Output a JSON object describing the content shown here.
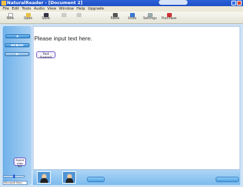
{
  "window": {
    "title": "NaturalReader - [Document 2]"
  },
  "menu": [
    "File",
    "Edit",
    "Tools",
    "Audio",
    "View",
    "Window",
    "Help",
    "Upgrade"
  ],
  "toolbar": [
    {
      "label": "New",
      "icon": "new-document-icon",
      "enabled": true
    },
    {
      "label": "Open",
      "icon": "open-folder-icon",
      "enabled": true
    },
    {
      "label": "Save",
      "icon": "save-disk-icon",
      "enabled": true
    },
    {
      "label": "",
      "icon": "cut-icon",
      "enabled": false
    },
    {
      "label": "",
      "icon": "copy-icon",
      "enabled": false
    },
    {
      "label": "Paste",
      "icon": "paste-icon",
      "enabled": true
    },
    {
      "label": "Undo",
      "icon": "undo-icon",
      "enabled": true
    },
    {
      "label": "Settings",
      "icon": "settings-icon",
      "enabled": true
    },
    {
      "label": "Purchase",
      "icon": "purchase-icon",
      "enabled": true
    }
  ],
  "editor": {
    "placeholder": "Please input text here."
  },
  "callouts": {
    "fast_forward": "Fast forward",
    "speed_slide_bar": "Speed slide bar"
  },
  "speed": {
    "select_value": "Microsoft Mary"
  },
  "colors": {
    "titlebar": "#2c62d8",
    "pane": "#6fb1ea",
    "callout_border": "#6b4fc8"
  }
}
